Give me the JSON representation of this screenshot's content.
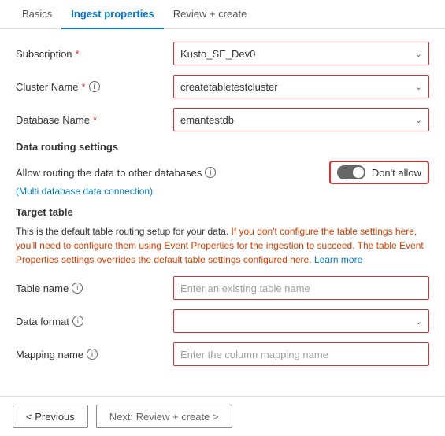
{
  "tabs": [
    {
      "id": "basics",
      "label": "Basics",
      "active": false
    },
    {
      "id": "ingest",
      "label": "Ingest properties",
      "active": true
    },
    {
      "id": "review",
      "label": "Review + create",
      "active": false
    }
  ],
  "form": {
    "subscription": {
      "label": "Subscription",
      "required": true,
      "value": "Kusto_SE_Dev0"
    },
    "cluster_name": {
      "label": "Cluster Name",
      "required": true,
      "has_info": true,
      "value": "createtabletestcluster"
    },
    "database_name": {
      "label": "Database Name",
      "required": true,
      "value": "emantestdb"
    }
  },
  "data_routing": {
    "section_label": "Data routing settings",
    "routing_label": "Allow routing the data to other databases",
    "multi_db_note": "(Multi database data connection)",
    "toggle_label": "Don't allow",
    "toggle_state": "off"
  },
  "target_table": {
    "section_label": "Target table",
    "info_text_normal_1": "This is the default table routing setup for your data.",
    "info_text_orange": " If you don't configure the table settings here, you'll need to configure them using Event Properties for the ingestion to succeed. The table Event Properties settings overrides the default table settings configured here.",
    "info_text_link": " Learn more",
    "table_name": {
      "label": "Table name",
      "has_info": true,
      "placeholder": "Enter an existing table name"
    },
    "data_format": {
      "label": "Data format",
      "has_info": true,
      "value": ""
    },
    "mapping_name": {
      "label": "Mapping name",
      "has_info": true,
      "placeholder": "Enter the column mapping name"
    }
  },
  "footer": {
    "previous_label": "< Previous",
    "next_label": "Next: Review + create >"
  }
}
